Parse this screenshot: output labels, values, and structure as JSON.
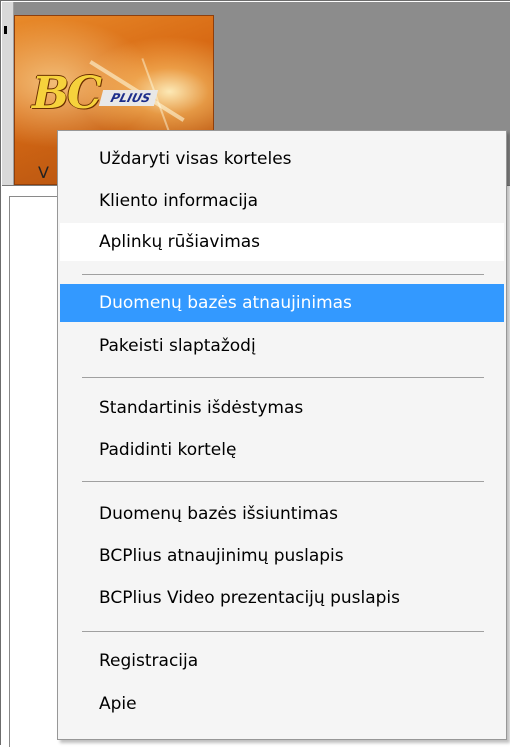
{
  "window": {
    "tab_text": "V"
  },
  "logo": {
    "brand_main": "BC",
    "brand_plus": "PLIUS"
  },
  "menu": {
    "items": [
      {
        "label": "Uždaryti visas korteles",
        "state": "normal"
      },
      {
        "label": "Kliento informacija",
        "state": "normal"
      },
      {
        "label": "Aplinkų rūšiavimas",
        "state": "normal"
      },
      {
        "label": "Duomenų bazės atnaujinimas",
        "state": "highlighted"
      },
      {
        "label": "Pakeisti slaptažodį",
        "state": "normal"
      },
      {
        "label": "Standartinis išdėstymas",
        "state": "normal"
      },
      {
        "label": "Padidinti kortelę",
        "state": "normal"
      },
      {
        "label": "Duomenų bazės išsiuntimas",
        "state": "normal"
      },
      {
        "label": "BCPlius atnaujinimų puslapis",
        "state": "normal"
      },
      {
        "label": "BCPlius Video prezentacijų puslapis",
        "state": "normal"
      },
      {
        "label": "Registracija",
        "state": "normal"
      },
      {
        "label": "Apie",
        "state": "normal"
      }
    ]
  },
  "colors": {
    "highlight": "#3399ff",
    "menu_background": "#f5f5f5",
    "logo_orange": "#d86a14"
  }
}
